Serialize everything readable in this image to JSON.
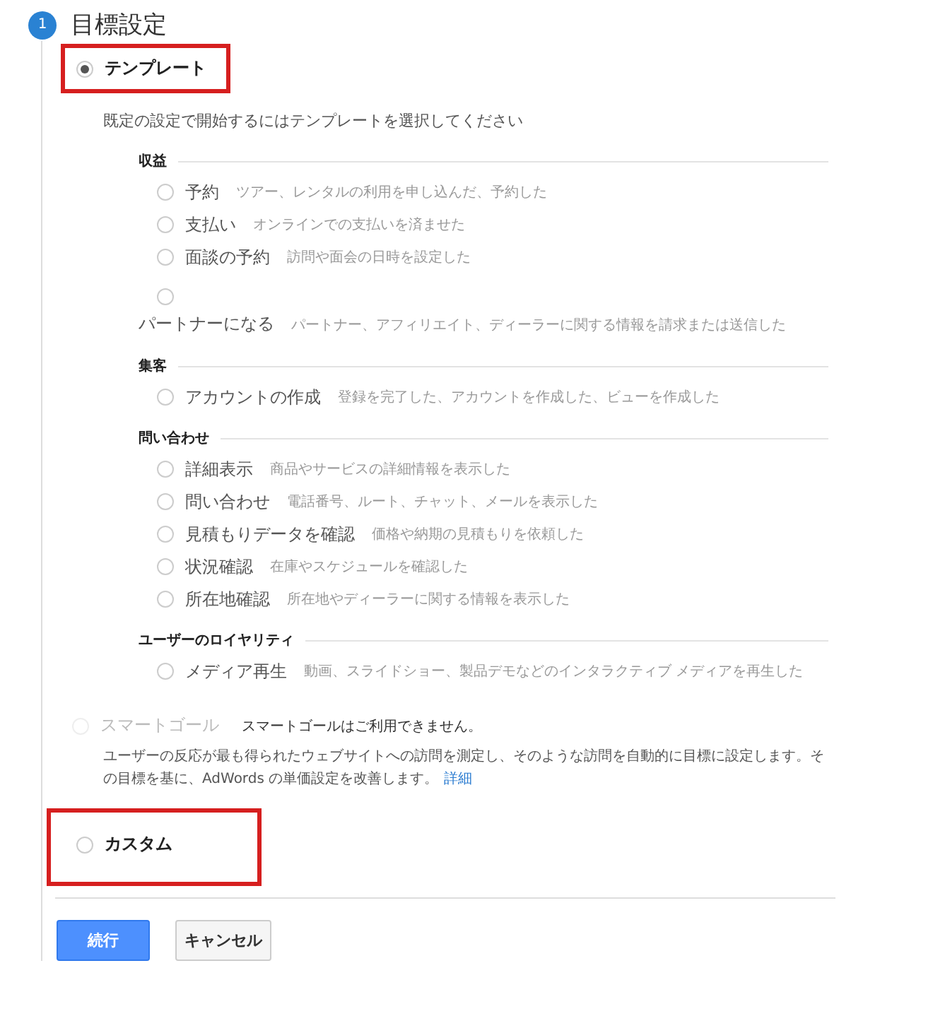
{
  "step": {
    "number": "1",
    "title": "目標設定"
  },
  "options": [
    {
      "kind": "template",
      "label": "テンプレート",
      "selected": true,
      "disabled": false,
      "highlighted": true,
      "description": "既定の設定で開始するにはテンプレートを選択してください",
      "groups": [
        {
          "heading": "収益",
          "items": [
            {
              "kind": "inline",
              "label": "予約",
              "description": "ツアー、レンタルの利用を申し込んだ、予約した",
              "selected": false
            },
            {
              "kind": "inline",
              "label": "支払い",
              "description": "オンラインでの支払いを済ませた",
              "selected": false
            },
            {
              "kind": "inline",
              "label": "面談の予約",
              "description": "訪問や面会の日時を設定した",
              "selected": false
            },
            {
              "kind": "stacked",
              "label": "パートナーになる",
              "description": "パートナー、アフィリエイト、ディーラーに関する情報を請求または送信した",
              "selected": false
            }
          ]
        },
        {
          "heading": "集客",
          "items": [
            {
              "kind": "inline",
              "label": "アカウントの作成",
              "description": "登録を完了した、アカウントを作成した、ビューを作成した",
              "selected": false
            }
          ]
        },
        {
          "heading": "問い合わせ",
          "items": [
            {
              "kind": "inline",
              "label": "詳細表示",
              "description": "商品やサービスの詳細情報を表示した",
              "selected": false
            },
            {
              "kind": "inline",
              "label": "問い合わせ",
              "description": "電話番号、ルート、チャット、メールを表示した",
              "selected": false
            },
            {
              "kind": "inline",
              "label": "見積もりデータを確認",
              "description": "価格や納期の見積もりを依頼した",
              "selected": false
            },
            {
              "kind": "inline",
              "label": "状況確認",
              "description": "在庫やスケジュールを確認した",
              "selected": false
            },
            {
              "kind": "inline",
              "label": "所在地確認",
              "description": "所在地やディーラーに関する情報を表示した",
              "selected": false
            }
          ]
        },
        {
          "heading": "ユーザーのロイヤリティ",
          "items": [
            {
              "kind": "inline",
              "label": "メディア再生",
              "description": "動画、スライドショー、製品デモなどのインタラクティブ メディアを再生した",
              "selected": false
            }
          ]
        }
      ]
    },
    {
      "kind": "smart",
      "label": "スマートゴール",
      "selected": false,
      "disabled": true,
      "note": "スマートゴールはご利用できません。",
      "description": "ユーザーの反応が最も得られたウェブサイトへの訪問を測定し、そのような訪問を自動的に目標に設定します。その目標を基に、AdWords の単価設定を改善します。",
      "link": "詳細"
    },
    {
      "kind": "custom",
      "label": "カスタム",
      "selected": false,
      "disabled": false,
      "highlighted": true
    }
  ],
  "buttons": [
    {
      "kind": "primary",
      "label": "続行"
    },
    {
      "kind": "secondary",
      "label": "キャンセル"
    }
  ]
}
